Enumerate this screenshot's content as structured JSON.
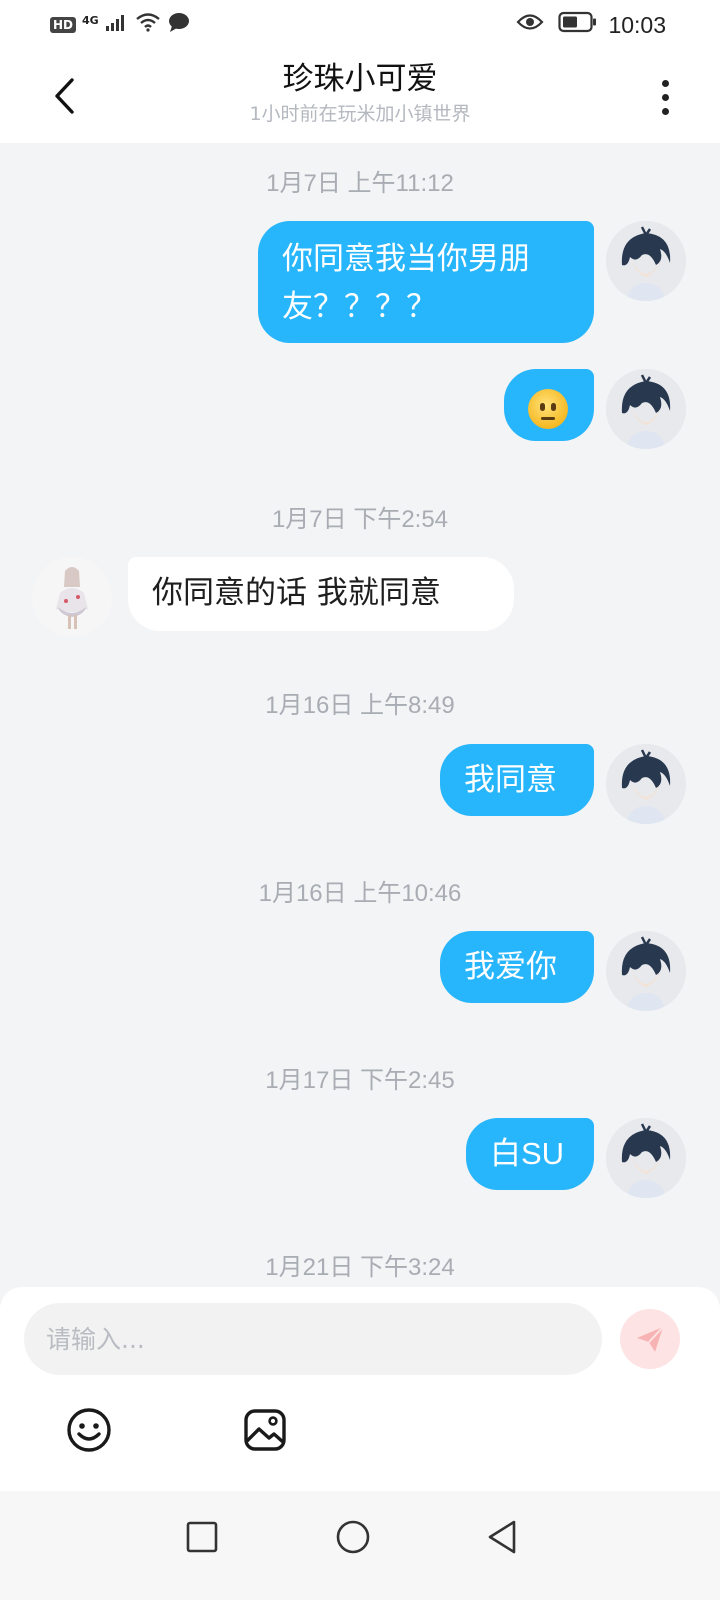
{
  "status_bar": {
    "hd": "HD",
    "network": "4G",
    "time": "10:03",
    "icons": [
      "signal-icon",
      "wifi-icon",
      "message-icon",
      "eye-icon",
      "battery-icon"
    ]
  },
  "header": {
    "title": "珍珠小可爱",
    "subtitle": "1小时前在玩米加小镇世界",
    "back_icon": "back-chevron-icon",
    "more_icon": "more-vertical-icon"
  },
  "messages": [
    {
      "type": "timestamp",
      "text": "1月7日 上午11:12"
    },
    {
      "type": "sent",
      "text": "你同意我当你男朋\n友？？？？"
    },
    {
      "type": "sent",
      "emoji": "neutral-face-emoji"
    },
    {
      "type": "timestamp",
      "text": "1月7日 下午2:54"
    },
    {
      "type": "received",
      "text": "你同意的话 我就同意"
    },
    {
      "type": "timestamp",
      "text": "1月16日 上午8:49"
    },
    {
      "type": "sent",
      "text": "我同意"
    },
    {
      "type": "timestamp",
      "text": "1月16日 上午10:46"
    },
    {
      "type": "sent",
      "text": "我爱你"
    },
    {
      "type": "timestamp",
      "text": "1月17日 下午2:45"
    },
    {
      "type": "sent",
      "text": "白SU"
    },
    {
      "type": "timestamp",
      "text": "1月21日 下午3:24"
    }
  ],
  "composer": {
    "placeholder": "请输入...",
    "value": "",
    "send_icon": "send-icon",
    "tools": [
      "emoji-icon",
      "image-icon"
    ]
  },
  "nav_bar": {
    "buttons": [
      "recent-apps-icon",
      "home-icon",
      "back-triangle-icon"
    ]
  },
  "colors": {
    "sent_bubble": "#27b5fb",
    "received_bubble": "#ffffff",
    "chat_background": "#f3f4f6",
    "send_button_bg": "#fde3e3",
    "send_arrow": "#f7b3b3"
  }
}
